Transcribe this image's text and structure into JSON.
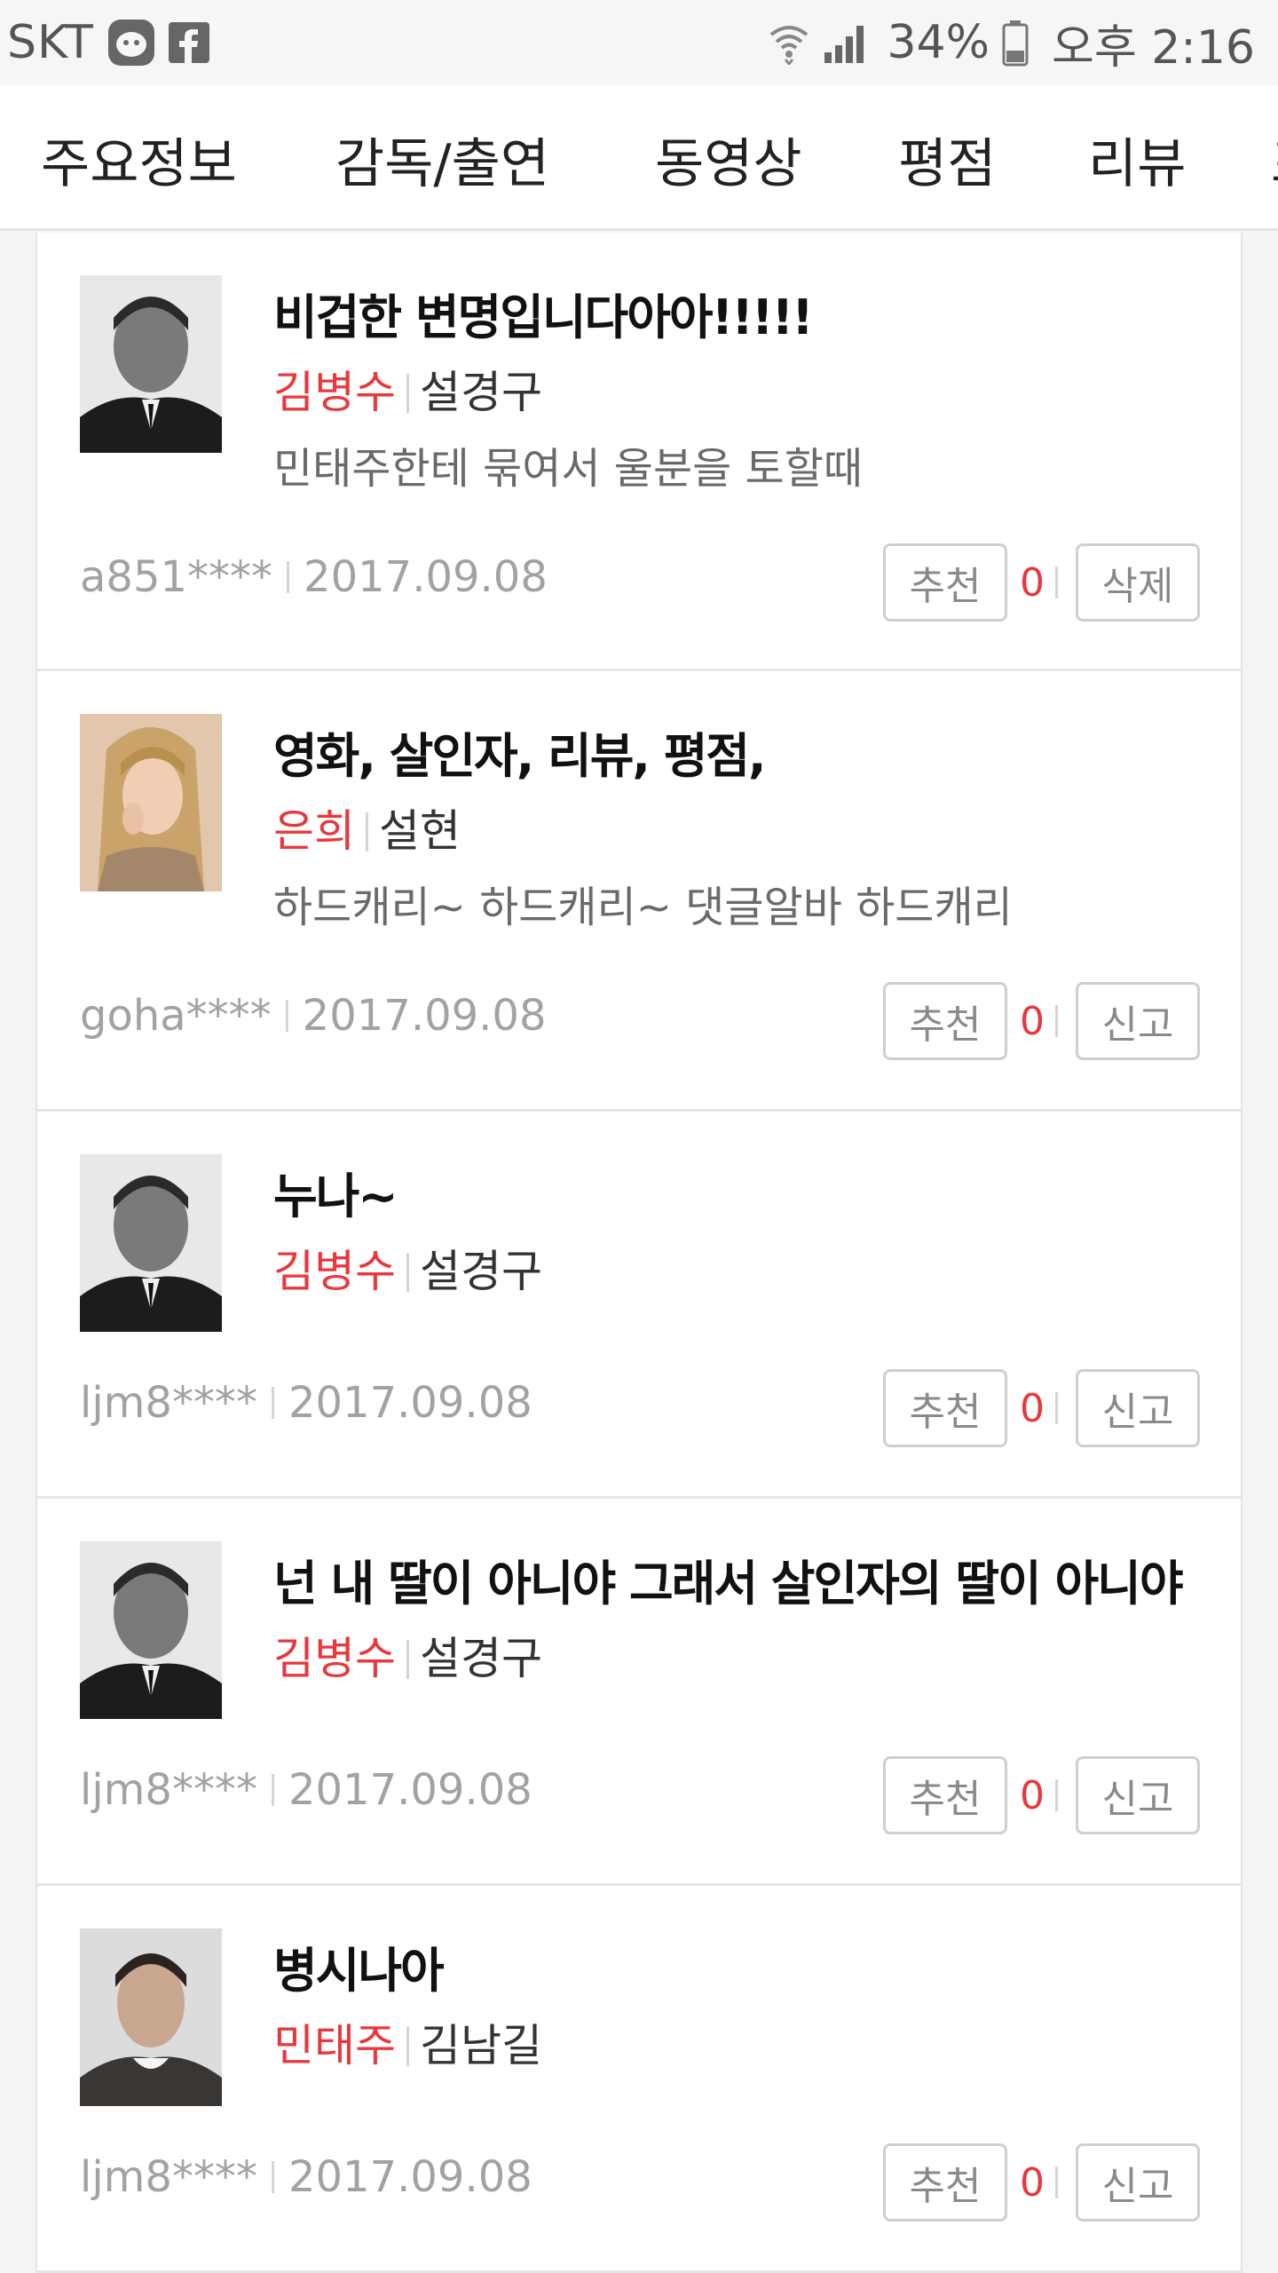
{
  "status_bar": {
    "carrier": "SKT",
    "battery_pct": "34%",
    "time": "오후 2:16",
    "icons": [
      "talk-app-icon",
      "facebook-icon",
      "wifi-icon",
      "signal-icon",
      "battery-icon"
    ]
  },
  "tabs": [
    "주요정보",
    "감독/출연",
    "동영상",
    "평점",
    "리뷰",
    "포"
  ],
  "colors": {
    "accent_red": "#e8383d",
    "meta_gray": "#a2a2a2"
  },
  "reviews": [
    {
      "title": "비겁한 변명입니다아아!!!!!",
      "role": "김병수",
      "actor": "설경구",
      "body": "민태주한테 묶여서 울분을 토할때",
      "user": "a851****",
      "date": "2017.09.08",
      "recommend_label": "추천",
      "recommend_count": "0",
      "action_label": "삭제",
      "thumb": "portrait-man-suit-bw"
    },
    {
      "title": "영화, 살인자, 리뷰, 평점,",
      "role": "은희",
      "actor": "설현",
      "body": "하드캐리~ 하드캐리~ 댓글알바 하드캐리",
      "user": "goha****",
      "date": "2017.09.08",
      "recommend_label": "추천",
      "recommend_count": "0",
      "action_label": "신고",
      "thumb": "portrait-woman-color"
    },
    {
      "title": "누나~",
      "role": "김병수",
      "actor": "설경구",
      "body": "",
      "user": "ljm8****",
      "date": "2017.09.08",
      "recommend_label": "추천",
      "recommend_count": "0",
      "action_label": "신고",
      "thumb": "portrait-man-suit-bw"
    },
    {
      "title": "넌 내 딸이 아니야 그래서 살인자의 딸이 아니야",
      "role": "김병수",
      "actor": "설경구",
      "body": "",
      "user": "ljm8****",
      "date": "2017.09.08",
      "recommend_label": "추천",
      "recommend_count": "0",
      "action_label": "신고",
      "thumb": "portrait-man-suit-bw"
    },
    {
      "title": "병시나아",
      "role": "민태주",
      "actor": "김남길",
      "body": "",
      "user": "ljm8****",
      "date": "2017.09.08",
      "recommend_label": "추천",
      "recommend_count": "0",
      "action_label": "신고",
      "thumb": "portrait-man-casual"
    }
  ]
}
